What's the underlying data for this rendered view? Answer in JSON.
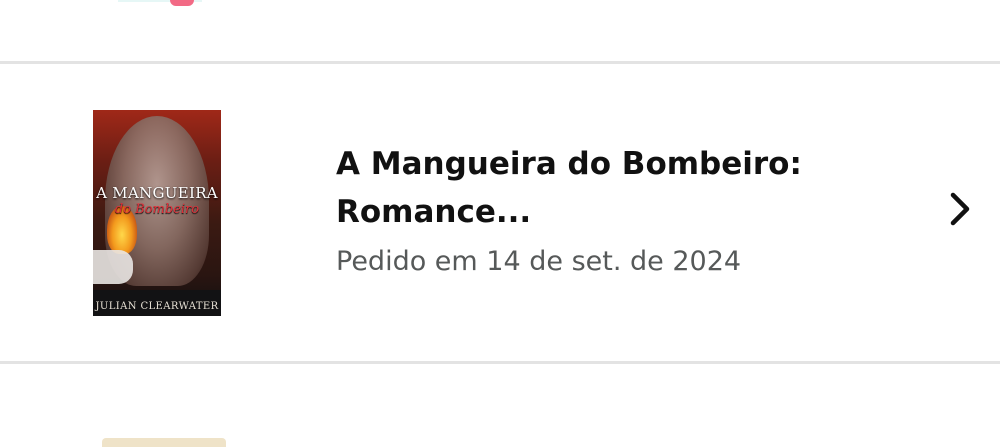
{
  "order": {
    "title_line1": "A Mangueira do Bombeiro:",
    "title_line2": "Romance...",
    "date": "Pedido em 14 de set. de 2024",
    "cover": {
      "title": "A MANGUEIRA",
      "subtitle": "do Bombeiro",
      "author": "JULIAN CLEARWATER"
    }
  },
  "icons": {
    "chevron": "chevron-right-icon"
  },
  "colors": {
    "title": "#111111",
    "date": "#565959",
    "divider": "#e3e3e3"
  }
}
